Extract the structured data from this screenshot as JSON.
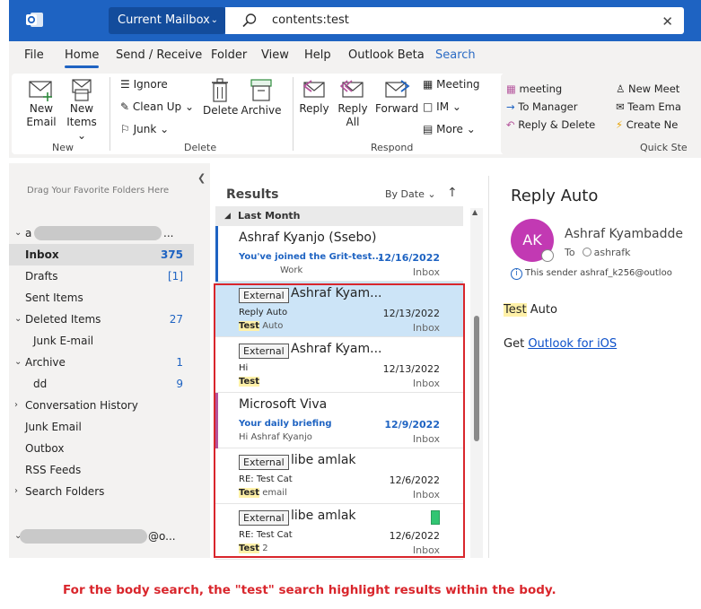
{
  "titlebar": {
    "mailbox_label": "Current Mailbox",
    "search_query": "contents:test"
  },
  "menu": [
    "File",
    "Home",
    "Send / Receive",
    "Folder",
    "View",
    "Help",
    "Outlook Beta",
    "Search"
  ],
  "ribbon": {
    "new_email": [
      "New",
      "Email"
    ],
    "new_items": [
      "New",
      "Items"
    ],
    "group_new": "New",
    "ignore": "Ignore",
    "clean_up": "Clean Up",
    "junk": "Junk",
    "delete": "Delete",
    "archive": "Archive",
    "group_delete": "Delete",
    "reply": "Reply",
    "reply_all": [
      "Reply",
      "All"
    ],
    "forward": "Forward",
    "meeting": "Meeting",
    "im": "IM",
    "more": "More",
    "group_respond": "Respond",
    "qs_meeting": "meeting",
    "qs_to_manager": "To Manager",
    "qs_reply_delete": "Reply & Delete",
    "qs_new_meet": "New Meet",
    "qs_team_email": "Team Ema",
    "qs_create_new": "Create Ne",
    "group_quick_steps": "Quick Ste"
  },
  "folders": {
    "fav_hint": "Drag Your Favorite Folders Here",
    "account1_prefix": "a",
    "account1_suffix": "...",
    "items": [
      {
        "name": "Inbox",
        "count": "375"
      },
      {
        "name": "Drafts",
        "count": "[1]"
      },
      {
        "name": "Sent Items",
        "count": ""
      },
      {
        "name": "Deleted Items",
        "count": "27"
      },
      {
        "name": "Junk E-mail",
        "count": ""
      },
      {
        "name": "Archive",
        "count": "1"
      },
      {
        "name": "dd",
        "count": "9"
      },
      {
        "name": "Conversation History",
        "count": ""
      },
      {
        "name": "Junk Email",
        "count": ""
      },
      {
        "name": "Outbox",
        "count": ""
      },
      {
        "name": "RSS Feeds",
        "count": ""
      },
      {
        "name": "Search Folders",
        "count": ""
      }
    ],
    "account2_suffix": "@o..."
  },
  "results": {
    "title": "Results",
    "sort": "By Date",
    "group": "Last Month",
    "ext_tag": "External",
    "mails": [
      {
        "sender": "Ashraf Kyanjo (Ssebo)",
        "subject": "You've joined the Grit-test...",
        "date": "12/16/2022",
        "preview": "Work",
        "folder": "Inbox"
      },
      {
        "sender": "Ashraf Kyam...",
        "subject": "Reply Auto",
        "date": "12/13/2022",
        "preview_hl": "Test",
        "preview_rest": " Auto",
        "folder": "Inbox"
      },
      {
        "sender": "Ashraf Kyam...",
        "subject": "Hi",
        "date": "12/13/2022",
        "preview_hl": "Test",
        "preview_rest": "",
        "folder": "Inbox"
      },
      {
        "sender": "Microsoft Viva",
        "subject": "Your daily briefing",
        "date": "12/9/2022",
        "preview": "Hi Ashraf Kyanjo",
        "folder": "Inbox"
      },
      {
        "sender": "libe amlak",
        "subject": "RE: Test Cat",
        "date": "12/6/2022",
        "preview_hl": "Test",
        "preview_rest": " email",
        "folder": "Inbox"
      },
      {
        "sender": "libe amlak",
        "subject": "RE: Test Cat",
        "date": "12/6/2022",
        "preview_hl": "Test",
        "preview_rest": " 2",
        "folder": "Inbox"
      }
    ]
  },
  "reading": {
    "subject": "Reply Auto",
    "avatar_initials": "AK",
    "from": "Ashraf Kyambadde",
    "to_label": "To",
    "to_name": "ashrafk",
    "info": "This sender ashraf_k256@outloo",
    "body_hl": "Test",
    "body_rest": " Auto",
    "get_prefix": "Get ",
    "link": "Outlook for iOS"
  },
  "caption": "For the body search, the \"test\" search highlight results within the body.",
  "colors": {
    "accent": "#1e63c2",
    "highlight": "#fff1a8",
    "annotation_red": "#d9262c",
    "avatar": "#c239b3",
    "flag": "#31c572"
  }
}
